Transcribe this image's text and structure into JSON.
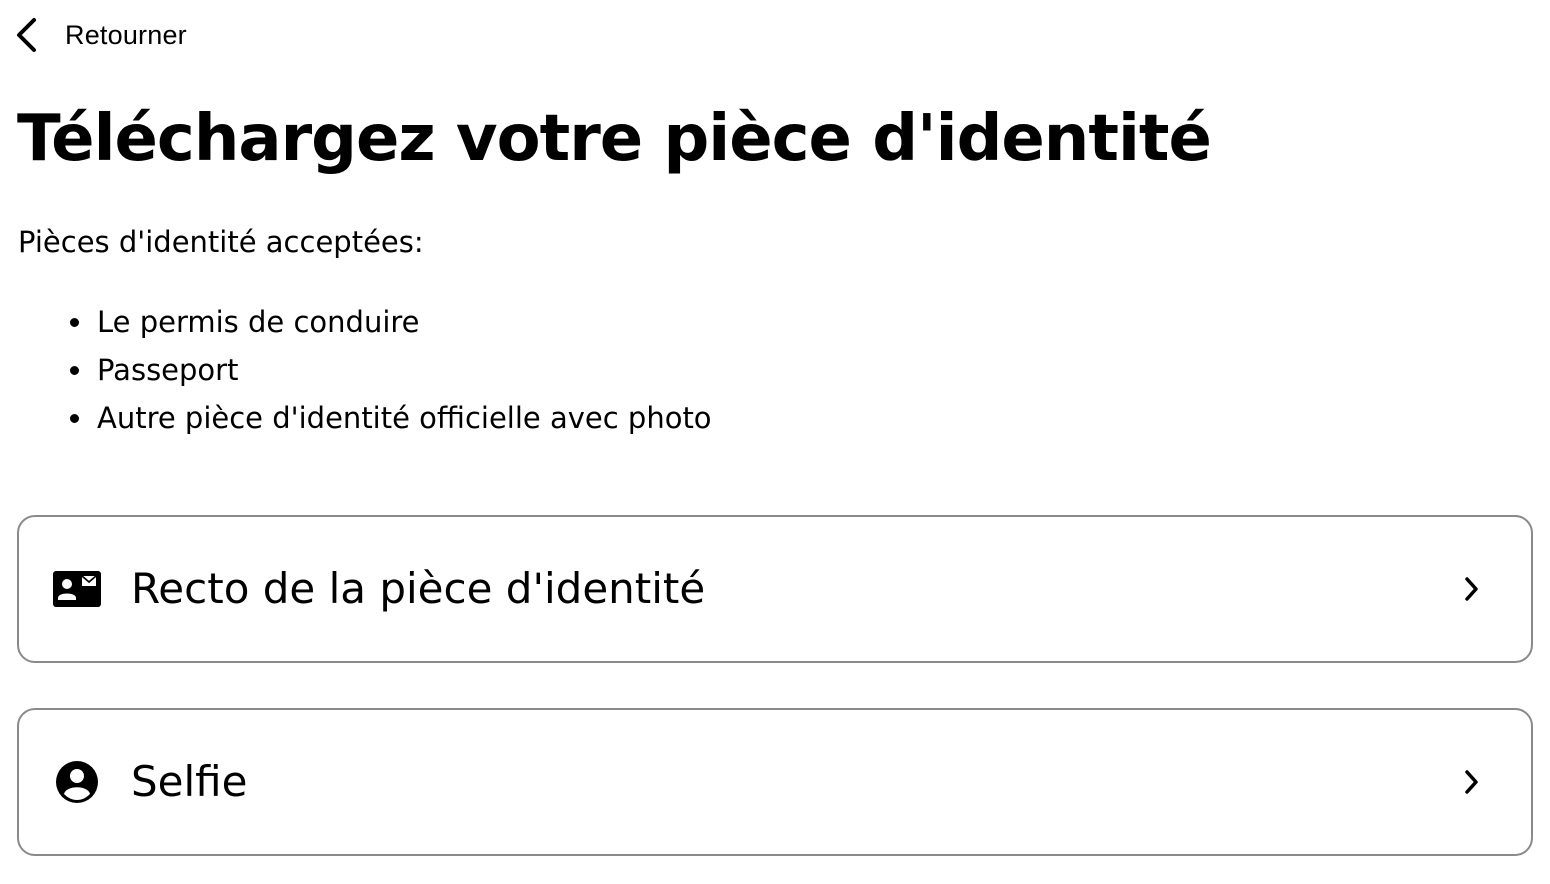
{
  "header": {
    "back_label": "Retourner",
    "back_icon": "chevron-left-icon"
  },
  "main": {
    "title": "Téléchargez votre pièce d'identité",
    "intro": "Pièces d'identité acceptées:",
    "accepted_documents": [
      "Le permis de conduire",
      "Passeport",
      "Autre pièce d'identité officielle avec photo"
    ]
  },
  "options": [
    {
      "label": "Recto de la pièce d'identité",
      "icon": "id-card-icon",
      "arrow_icon": "chevron-right-icon"
    },
    {
      "label": "Selfie",
      "icon": "account-circle-icon",
      "arrow_icon": "chevron-right-icon"
    }
  ],
  "colors": {
    "text": "#000000",
    "card_border": "#8a8a8a",
    "background": "#ffffff"
  }
}
